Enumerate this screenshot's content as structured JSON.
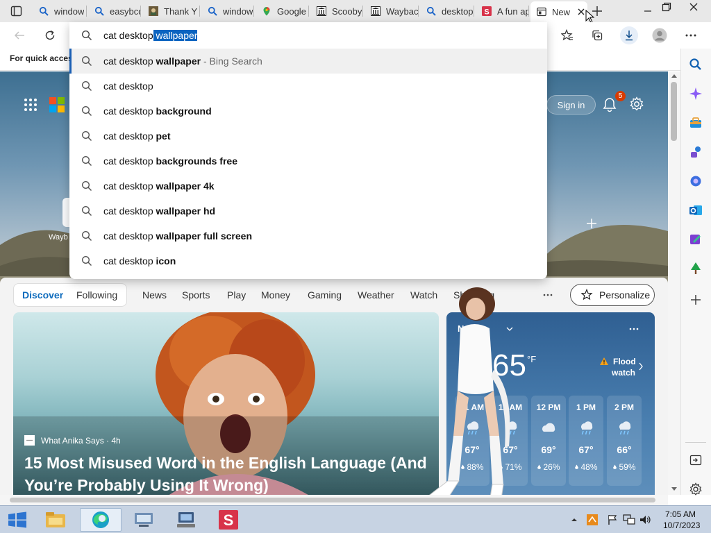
{
  "tabs": [
    {
      "title": "window",
      "icon": "search-icon"
    },
    {
      "title": "easybcd",
      "icon": "search-icon"
    },
    {
      "title": "Thank Y",
      "icon": "game-favicon"
    },
    {
      "title": "window",
      "icon": "search-icon"
    },
    {
      "title": "Google",
      "icon": "maps-pin-icon"
    },
    {
      "title": "Scooby",
      "icon": "archive-icon"
    },
    {
      "title": "Waybac",
      "icon": "archive-icon"
    },
    {
      "title": "desktop",
      "icon": "search-icon"
    },
    {
      "title": "A fun ap",
      "icon": "s-brand-icon"
    },
    {
      "title": "New",
      "icon": "newtab-icon",
      "active": true
    }
  ],
  "address": {
    "typed": "cat desktop",
    "autocomplete": " wallpaper"
  },
  "favorites_bar": {
    "text": "For quick access"
  },
  "suggestions": [
    {
      "plain": "cat desktop ",
      "bold": "wallpaper",
      "suffix": " - Bing Search",
      "highlighted": true
    },
    {
      "plain": "cat desktop",
      "bold": "",
      "suffix": ""
    },
    {
      "plain": "cat desktop ",
      "bold": "background",
      "suffix": ""
    },
    {
      "plain": "cat desktop ",
      "bold": "pet",
      "suffix": ""
    },
    {
      "plain": "cat desktop ",
      "bold": "backgrounds free",
      "suffix": ""
    },
    {
      "plain": "cat desktop ",
      "bold": "wallpaper 4k",
      "suffix": ""
    },
    {
      "plain": "cat desktop ",
      "bold": "wallpaper hd",
      "suffix": ""
    },
    {
      "plain": "cat desktop ",
      "bold": "wallpaper full screen",
      "suffix": ""
    },
    {
      "plain": "cat desktop ",
      "bold": "icon",
      "suffix": ""
    }
  ],
  "page": {
    "sign_in": "Sign in",
    "notification_count": "5",
    "quicklink_label": "Wayb",
    "nav": [
      "Discover",
      "Following",
      "News",
      "Sports",
      "Play",
      "Money",
      "Gaming",
      "Weather",
      "Watch",
      "Shopping"
    ],
    "personalize": "Personalize",
    "article": {
      "source": "What Anika Says · 4h",
      "headline_line1": "15 Most Misused Word in the English Language (And",
      "headline_line2": "You’re Probably Using It Wrong)"
    },
    "weather": {
      "location": "Ne",
      "temp": "65",
      "unit": "°F",
      "alert_line1": "Flood",
      "alert_line2": "watch",
      "hours": [
        {
          "time": "11 AM",
          "temp": "67°",
          "precip": "88%",
          "icon": "rain-icon"
        },
        {
          "time": "11 AM",
          "temp": "67°",
          "precip": "71%",
          "icon": "rain-icon"
        },
        {
          "time": "12 PM",
          "temp": "69°",
          "precip": "26%",
          "icon": "cloud-icon"
        },
        {
          "time": "1 PM",
          "temp": "67°",
          "precip": "48%",
          "icon": "rain-icon"
        },
        {
          "time": "2 PM",
          "temp": "66°",
          "precip": "59%",
          "icon": "rain-icon"
        }
      ]
    }
  },
  "clock": {
    "time": "7:05 AM",
    "date": "10/7/2023"
  },
  "colors": {
    "accent": "#0f6cbd",
    "weather_bg": "#3f6ea0",
    "badge": "#d83b01"
  }
}
